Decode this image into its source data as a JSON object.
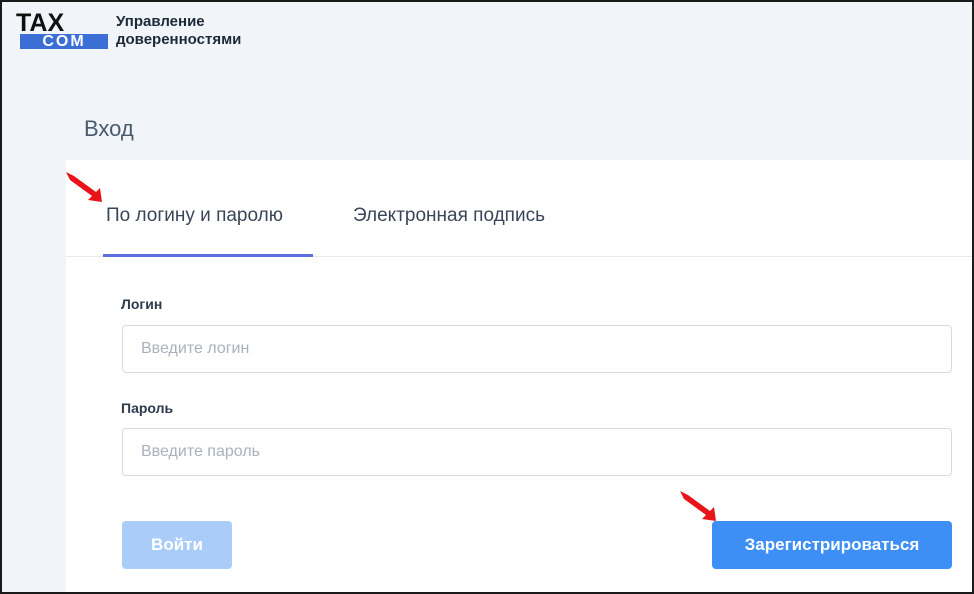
{
  "logo": {
    "top_text": "TAX",
    "bottom_text": "COM"
  },
  "app_title": {
    "line1": "Управление",
    "line2": "доверенностями"
  },
  "page_title": "Вход",
  "tabs": [
    {
      "label": "По логину и паролю",
      "active": true
    },
    {
      "label": "Электронная подпись",
      "active": false
    }
  ],
  "form": {
    "login_label": "Логин",
    "login_placeholder": "Введите логин",
    "password_label": "Пароль",
    "password_placeholder": "Введите пароль"
  },
  "buttons": {
    "login": "Войти",
    "register": "Зарегистрироваться"
  },
  "colors": {
    "accent": "#3d8ff5",
    "accent_disabled": "#a9cdf8",
    "tab_underline": "#5b6fe0",
    "logo_blue": "#3b6fd6",
    "annotation_arrow": "#e8141a"
  },
  "icons": [
    "annotation-arrow-icon"
  ]
}
